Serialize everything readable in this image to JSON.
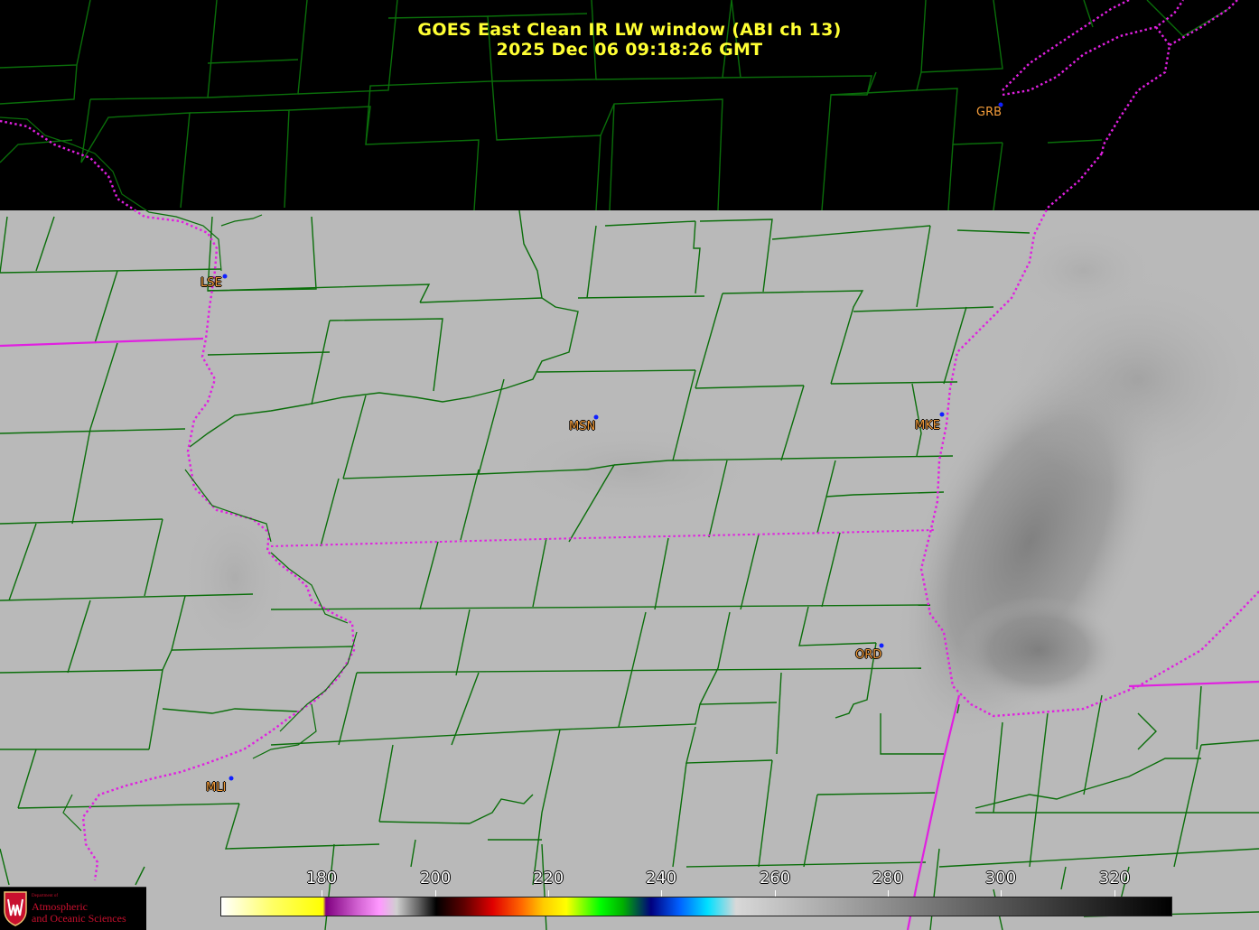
{
  "title": "GOES East Clean IR LW window (ABI ch 13)",
  "subtitle": "2025 Dec 06  09:18:26 GMT",
  "stations": [
    {
      "id": "GRB"
    },
    {
      "id": "LSE"
    },
    {
      "id": "MSN"
    },
    {
      "id": "MKE"
    },
    {
      "id": "ORD"
    },
    {
      "id": "MLI"
    }
  ],
  "colorbar": {
    "min": 162,
    "max": 330,
    "ticks": [
      "180",
      "200",
      "220",
      "240",
      "260",
      "280",
      "300",
      "320"
    ]
  },
  "logo": {
    "small_text": "Department of",
    "line1": "Atmospheric",
    "line2": "and Oceanic Sciences"
  },
  "colors": {
    "title": "#ffff33",
    "station_label": "#f39c3a",
    "station_dot": "#1020ff",
    "state_border": "#e020e0",
    "county_border": "#0a6e0a",
    "cloud_free_gray": "#b8b8b8",
    "no_data": "#000000"
  }
}
